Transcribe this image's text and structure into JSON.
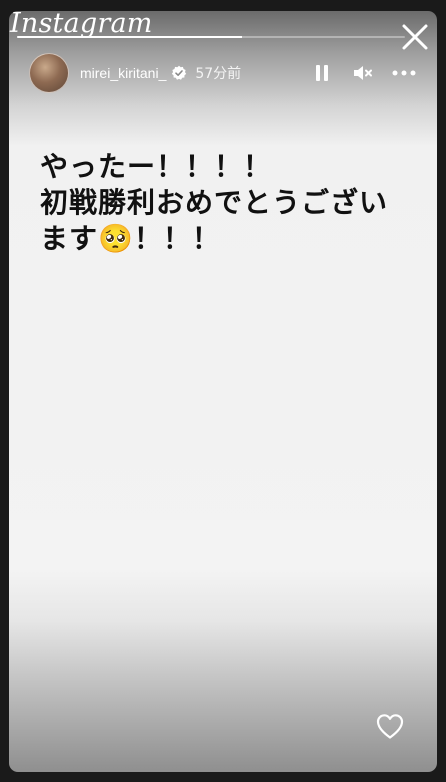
{
  "brand": {
    "logo_text": "Instagram"
  },
  "story": {
    "progress_fraction": 0.58,
    "username": "mirei_kiritani_",
    "timestamp": "57分前",
    "caption": "やったー！！！！\n初戦勝利おめでとうござい\nます🥺！！！"
  },
  "icons": {
    "close": "close-icon",
    "verified": "verified-badge-icon",
    "pause": "pause-icon",
    "mute": "muted-speaker-icon",
    "more": "more-options-icon",
    "like": "heart-icon"
  },
  "colors": {
    "background": "#1a1a1a",
    "card_top": "#6b6b6b",
    "card_mid": "#f3f3f3",
    "card_bottom": "#8f8f8f",
    "caption_text": "#111111"
  }
}
